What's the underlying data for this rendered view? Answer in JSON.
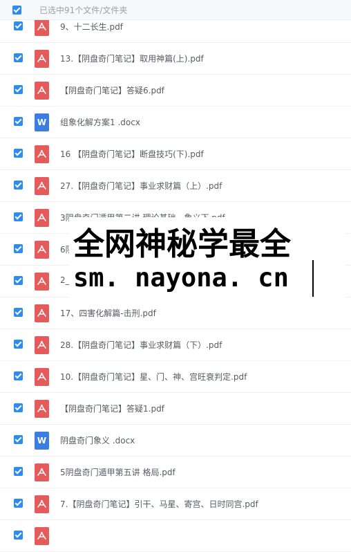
{
  "header": {
    "title": "已选中91个文件/文件夹"
  },
  "files": [
    {
      "name": "9、十二长生.pdf",
      "type": "pdf"
    },
    {
      "name": "13.【阴盘奇门笔记】取用神篇(上).pdf",
      "type": "pdf"
    },
    {
      "name": "【阴盘奇门笔记】答疑6.pdf",
      "type": "pdf"
    },
    {
      "name": "组象化解方案1 .docx",
      "type": "docx"
    },
    {
      "name": "16 【阴盘奇门笔记】断盘技巧(下).pdf",
      "type": "pdf"
    },
    {
      "name": "27.【阴盘奇门笔记】事业求财篇（上）.pdf",
      "type": "pdf"
    },
    {
      "name": "3阴盘奇门遁甲第二讲 理论基础—象义下.pdf",
      "type": "pdf"
    },
    {
      "name": "6阴",
      "type": "pdf"
    },
    {
      "name": "2_",
      "type": "pdf"
    },
    {
      "name": "17、四害化解篇-击刑.pdf",
      "type": "pdf"
    },
    {
      "name": "28.【阴盘奇门笔记】事业求财篇（下）.pdf",
      "type": "pdf"
    },
    {
      "name": "10.【阴盘奇门笔记】星、门、神、宫旺衰判定.pdf",
      "type": "pdf"
    },
    {
      "name": "【阴盘奇门笔记】答疑1.pdf",
      "type": "pdf"
    },
    {
      "name": "阴盘奇门象义 .docx",
      "type": "docx"
    },
    {
      "name": "5阴盘奇门遁甲第五讲 格局.pdf",
      "type": "pdf"
    },
    {
      "name": "7.【阴盘奇门笔记】引干、马星、寄宫、日时同宫.pdf",
      "type": "pdf"
    },
    {
      "name": "",
      "type": "pdf"
    }
  ],
  "icons": {
    "pdf": "pdf-file-icon",
    "docx": "word-file-icon",
    "docx_letter": "W"
  },
  "watermark": {
    "line1": "全网神秘学最全",
    "line2": "sm. nayona. cn"
  },
  "colors": {
    "checkbox": "#2e8cf0",
    "pdf": "#e55a5a",
    "docx": "#3b7de0"
  }
}
